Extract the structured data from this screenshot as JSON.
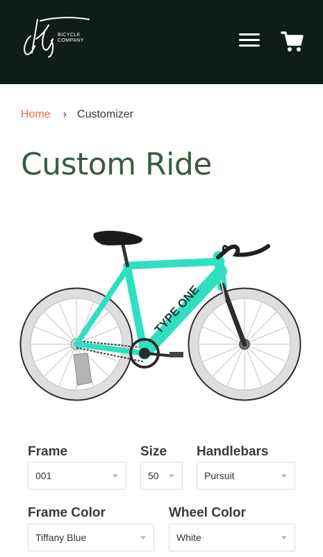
{
  "header": {
    "logo_script": "city",
    "logo_sub": [
      "BICYCLE",
      "COMPANY"
    ],
    "background": "#0f1c17",
    "menu_icon": "hamburger-menu-icon",
    "cart_icon": "shopping-cart-icon"
  },
  "breadcrumb": {
    "home": "Home",
    "separator": "›",
    "current": "Customizer"
  },
  "page": {
    "title": "Custom Ride"
  },
  "bike": {
    "frame_text": "TYPE ONE",
    "frame_color": "#2ee0c0"
  },
  "options": {
    "frame": {
      "label": "Frame",
      "value": "001"
    },
    "size": {
      "label": "Size",
      "value": "50"
    },
    "handlebars": {
      "label": "Handlebars",
      "value": "Pursuit"
    },
    "frame_color": {
      "label": "Frame Color",
      "value": "Tiffany Blue"
    },
    "wheel_color": {
      "label": "Wheel Color",
      "value": "White"
    }
  },
  "colors": {
    "accent": "#e3713a",
    "title": "#3b5b40"
  }
}
